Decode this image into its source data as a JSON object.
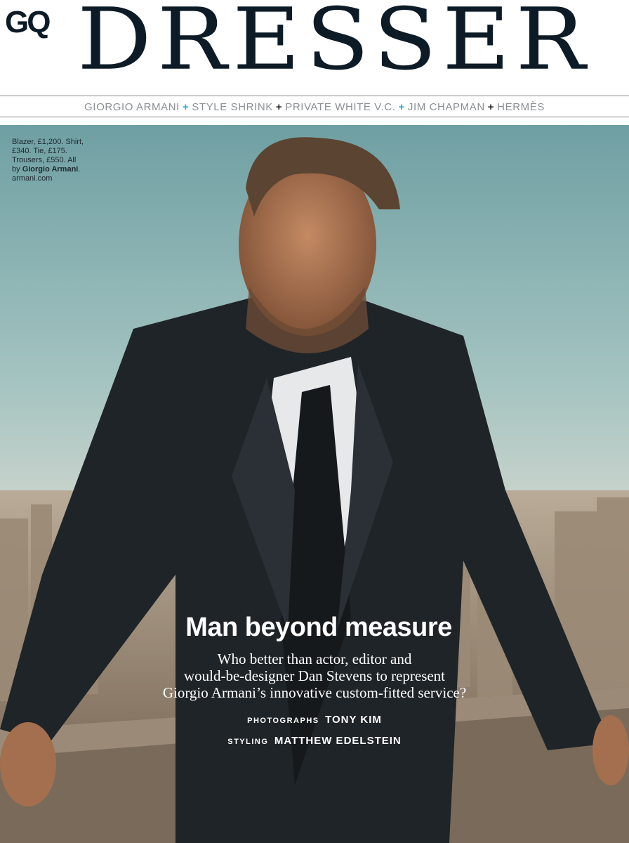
{
  "masthead": {
    "logo": "GQ",
    "title": "DRESSER"
  },
  "nav": {
    "items": [
      "GIORGIO ARMANI",
      "STYLE SHRINK",
      "PRIVATE WHITE V.C.",
      "JIM CHAPMAN",
      "HERMÈS"
    ],
    "separators": [
      "+",
      "+",
      "+",
      "+"
    ],
    "separator_colors": [
      "#26a8de",
      "#222222",
      "#26a8de",
      "#222222"
    ]
  },
  "credit": {
    "line1": "Blazer, £1,200. Shirt,",
    "line2": "£340. Tie, £175.",
    "line3": "Trousers, £550. All",
    "line4_prefix": "by ",
    "brand": "Giorgio Armani",
    "line4_suffix": ".",
    "website": "armani.com"
  },
  "article": {
    "headline": "Man beyond measure",
    "standfirst": [
      "Who better than actor, editor and",
      "would-be-designer Dan Stevens to represent",
      "Giorgio Armani’s innovative custom-fitted service?"
    ],
    "photographs_label": "PHOTOGRAPHS",
    "photographer": "TONY KIM",
    "styling_label": "STYLING",
    "stylist": "MATTHEW EDELSTEIN"
  },
  "colors": {
    "masthead_text": "#0d1b26",
    "nav_text": "#8a8f94",
    "accent_blue": "#26a8de",
    "suit": "#1f2428"
  }
}
